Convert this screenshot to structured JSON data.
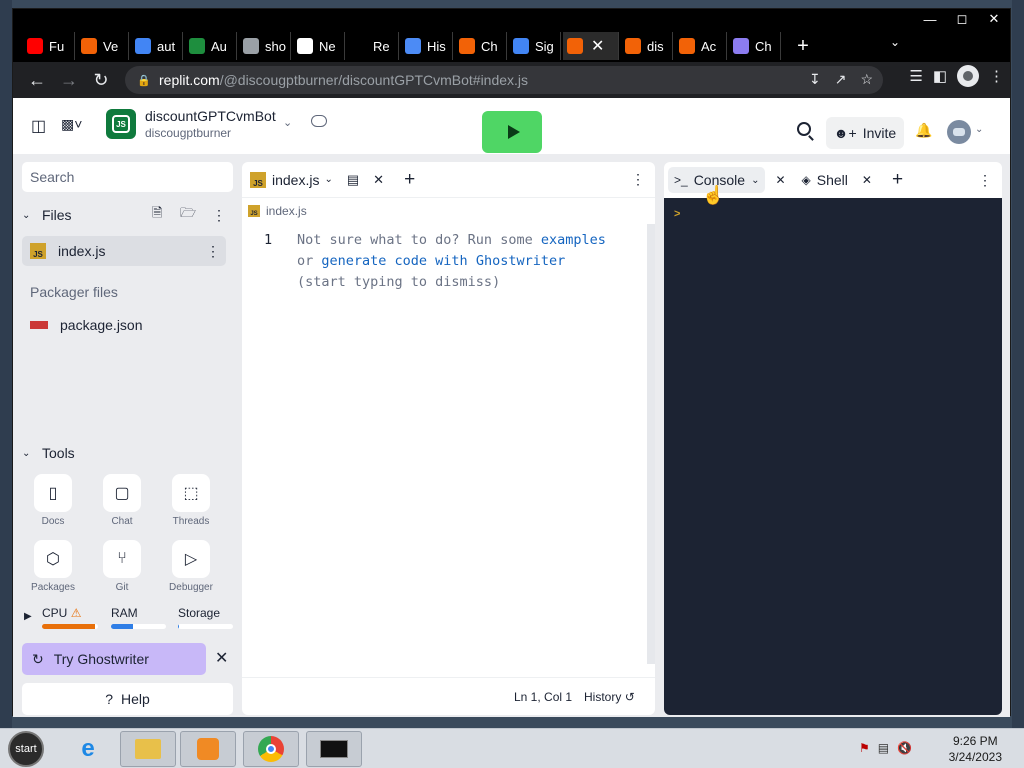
{
  "browser": {
    "tabs": [
      {
        "label": "Fu",
        "icon": "youtube-icon",
        "color": "#ff0000"
      },
      {
        "label": "Ve",
        "icon": "replit-icon",
        "color": "#f26207"
      },
      {
        "label": "aut",
        "icon": "google-icon",
        "color": "#4285f4"
      },
      {
        "label": "Au",
        "icon": "y-icon",
        "color": "#1e8e3e"
      },
      {
        "label": "sho",
        "icon": "globe-icon",
        "color": "#9aa0a6"
      },
      {
        "label": "Ne",
        "icon": "chatgpt-icon",
        "color": "#ffffff"
      },
      {
        "label": "Re",
        "icon": "blank-icon",
        "color": "#000000"
      },
      {
        "label": "His",
        "icon": "history-icon",
        "color": "#4c8bf5"
      },
      {
        "label": "Ch",
        "icon": "replit-icon",
        "color": "#f26207"
      },
      {
        "label": "Sig",
        "icon": "google-icon",
        "color": "#4285f4"
      },
      {
        "label": "",
        "icon": "replit-icon",
        "color": "#f26207",
        "active": true
      },
      {
        "label": "dis",
        "icon": "replit-icon",
        "color": "#f26207"
      },
      {
        "label": "Ac",
        "icon": "replit-icon",
        "color": "#f26207"
      },
      {
        "label": "Ch",
        "icon": "chatgpt-icon",
        "color": "#8c7cf0"
      }
    ],
    "url_domain": "replit.com",
    "url_path": "/@discougptburner/discountGPTCvmBot#index.js"
  },
  "header": {
    "repl_name": "discountGPTCvmBot",
    "owner": "discougptburner",
    "invite_label": "Invite",
    "logo_text": "JS"
  },
  "sidebar": {
    "search_placeholder": "Search",
    "files_title": "Files",
    "files": [
      {
        "name": "index.js",
        "selected": true
      }
    ],
    "packager_title": "Packager files",
    "packager_files": [
      {
        "name": "package.json"
      }
    ],
    "tools_title": "Tools",
    "tools": [
      {
        "label": "Docs",
        "icon": "book-icon"
      },
      {
        "label": "Chat",
        "icon": "chat-icon"
      },
      {
        "label": "Threads",
        "icon": "inbox-icon"
      },
      {
        "label": "Packages",
        "icon": "cube-icon"
      },
      {
        "label": "Git",
        "icon": "git-icon"
      },
      {
        "label": "Debugger",
        "icon": "debugger-icon"
      }
    ],
    "resources": {
      "cpu": "CPU",
      "ram": "RAM",
      "storage": "Storage",
      "cpu_level": 0.95,
      "ram_level": 0.4,
      "storage_level": 0.02
    },
    "ghostwriter_label": "Try Ghostwriter",
    "help_label": "Help"
  },
  "editor": {
    "tab_label": "index.js",
    "breadcrumb": "index.js",
    "line_number": "1",
    "hint_part1": "Not sure what to do? Run some ",
    "hint_link1": "examples",
    "hint_part2": "or ",
    "hint_link2": "generate code with Ghostwriter",
    "hint_part3": "(start typing to dismiss)",
    "status_pos": "Ln 1, Col 1",
    "history_label": "History"
  },
  "console": {
    "console_tab": "Console",
    "shell_tab": "Shell",
    "prompt": ">"
  },
  "taskbar": {
    "start_label": "start",
    "time": "9:26 PM",
    "date": "3/24/2023"
  }
}
